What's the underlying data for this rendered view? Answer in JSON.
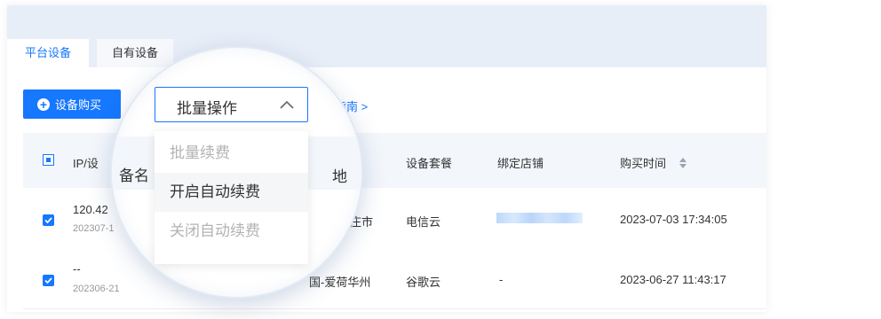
{
  "tabs": [
    {
      "label": "平台设备",
      "active": true
    },
    {
      "label": "自有设备",
      "active": false
    }
  ],
  "toolbar": {
    "buy_label": "设备购买",
    "guide_label": "指南 >",
    "batch_label": "批量操作"
  },
  "batch_menu": [
    {
      "label": "批量续费",
      "disabled": true
    },
    {
      "label": "开启自动续费",
      "disabled": false,
      "hovered": true
    },
    {
      "label": "关闭自动续费",
      "disabled": true
    }
  ],
  "table": {
    "headers": {
      "ip": "IP/设",
      "remark": "备名",
      "location": "地",
      "package": "设备套餐",
      "store": "绑定店铺",
      "buy_time": "购买时间"
    },
    "rows": [
      {
        "ip": "120.42",
        "id": "202307-1",
        "location": "庄市",
        "package": "电信云",
        "store": "",
        "buy_time": "2023-07-03 17:34:05",
        "checked": true
      },
      {
        "ip": "--",
        "id": "202306-21",
        "location": "国-爱荷华州",
        "package": "谷歌云",
        "store": "-",
        "buy_time": "2023-06-27 11:43:17",
        "checked": true
      }
    ]
  },
  "colors": {
    "primary": "#1677ff",
    "tabbar_bg": "#e8eef8",
    "header_bg": "#f3f6fb"
  },
  "icons": {
    "plus": "plus-circle-icon",
    "sort": "sort-icon",
    "chevron": "chevron-up-icon",
    "check": "check-icon"
  }
}
